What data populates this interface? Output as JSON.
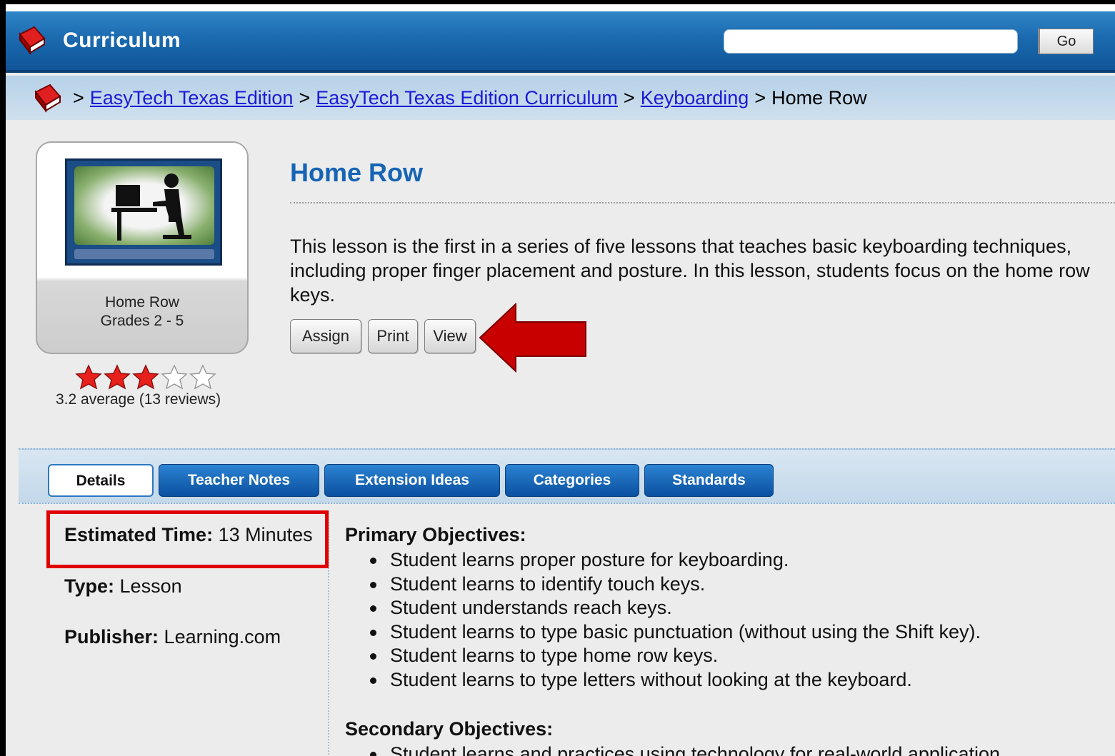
{
  "header": {
    "title": "Curriculum",
    "search_placeholder": "",
    "go_label": "Go"
  },
  "breadcrumb": {
    "items": [
      "EasyTech Texas Edition",
      "EasyTech Texas Edition Curriculum",
      "Keyboarding"
    ],
    "current": "Home Row",
    "separator": ">"
  },
  "card": {
    "title": "Home Row",
    "grades": "Grades 2 - 5",
    "rating_stars_filled": 3,
    "rating_stars_total": 5,
    "rating_text": "3.2 average (13 reviews)"
  },
  "lesson": {
    "title": "Home Row",
    "description": "This lesson is the first in a series of five lessons that teaches basic keyboarding techniques, including proper finger placement and posture. In this lesson, students focus on the home row keys.",
    "buttons": {
      "assign": "Assign",
      "print": "Print",
      "view": "View"
    }
  },
  "tabs": [
    "Details",
    "Teacher Notes",
    "Extension Ideas",
    "Categories",
    "Standards"
  ],
  "details": {
    "time_label": "Estimated Time:",
    "time_value": "13 Minutes",
    "type_label": "Type:",
    "type_value": "Lesson",
    "publisher_label": "Publisher:",
    "publisher_value": "Learning.com"
  },
  "objectives": {
    "primary_heading": "Primary Objectives:",
    "primary": [
      "Student learns proper posture for keyboarding.",
      "Student learns to identify touch keys.",
      "Student understands reach keys.",
      "Student learns to type basic punctuation (without using the Shift key).",
      "Student learns to type home row keys.",
      "Student learns to type letters without looking at the keyboard."
    ],
    "secondary_heading": "Secondary Objectives:",
    "secondary": [
      "Student learns and practices using technology for real-world application."
    ]
  },
  "colors": {
    "header_blue": "#1b6aaf",
    "link_blue": "#1a1ad6",
    "title_blue": "#1664b4",
    "annotation_red": "#e00000",
    "star_filled": "#e8201c"
  },
  "icons": [
    "book-icon",
    "star-icon",
    "red-arrow-annotation"
  ]
}
